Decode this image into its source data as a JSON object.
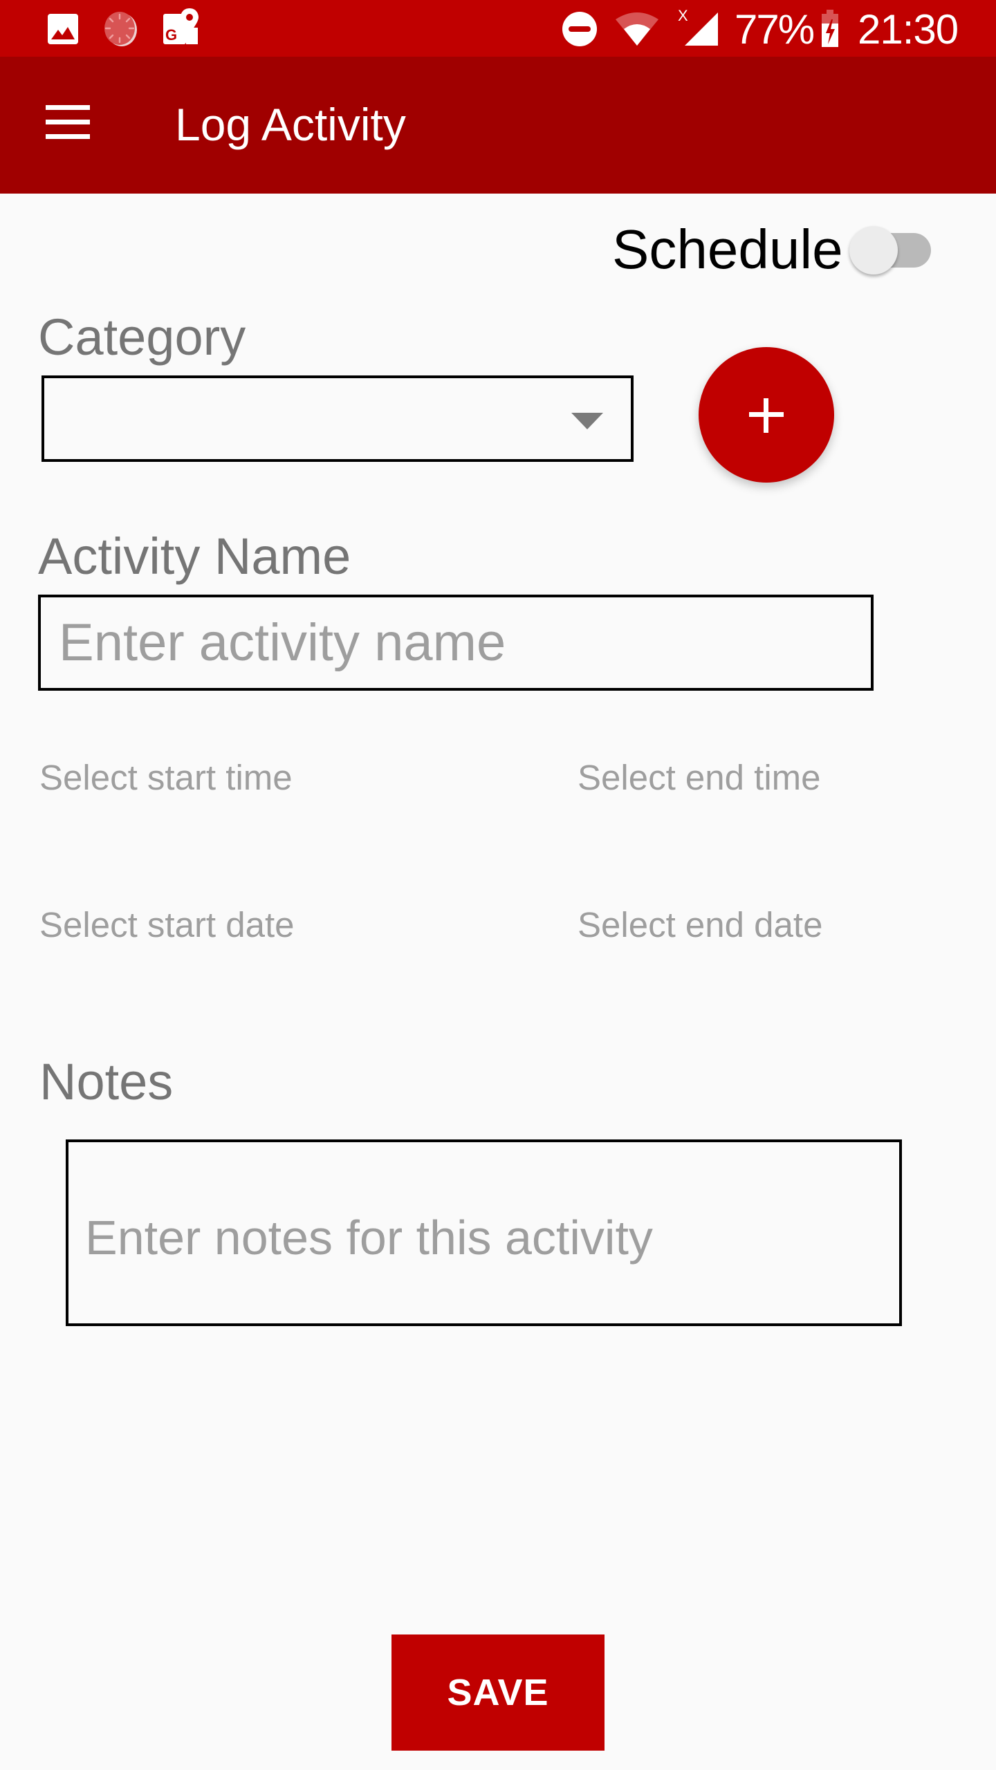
{
  "status_bar": {
    "left_icons": [
      "gallery-icon",
      "loading-icon",
      "google-maps-icon"
    ],
    "right_icons": [
      "do-not-disturb-icon",
      "wifi-icon",
      "cell-signal-icon",
      "battery-charging-icon"
    ],
    "battery_percent": "77%",
    "time": "21:30",
    "color": "#c00000"
  },
  "app_bar": {
    "title": "Log Activity",
    "menu_icon": "hamburger-menu-icon",
    "color": "#a00000"
  },
  "form": {
    "schedule": {
      "label": "Schedule",
      "enabled": false
    },
    "category": {
      "label": "Category",
      "selected_value": "",
      "add_button_icon": "plus-icon"
    },
    "activity_name": {
      "label": "Activity Name",
      "value": "",
      "placeholder": "Enter activity name"
    },
    "start_time": "Select start time",
    "end_time": "Select end time",
    "start_date": "Select start date",
    "end_date": "Select end date",
    "notes": {
      "label": "Notes",
      "value": "",
      "placeholder": "Enter notes for this activity"
    },
    "save_label": "SAVE"
  },
  "colors": {
    "accent": "#c00000",
    "label_gray": "#757575",
    "placeholder_gray": "#9e9e9e",
    "background": "#fafafa"
  }
}
